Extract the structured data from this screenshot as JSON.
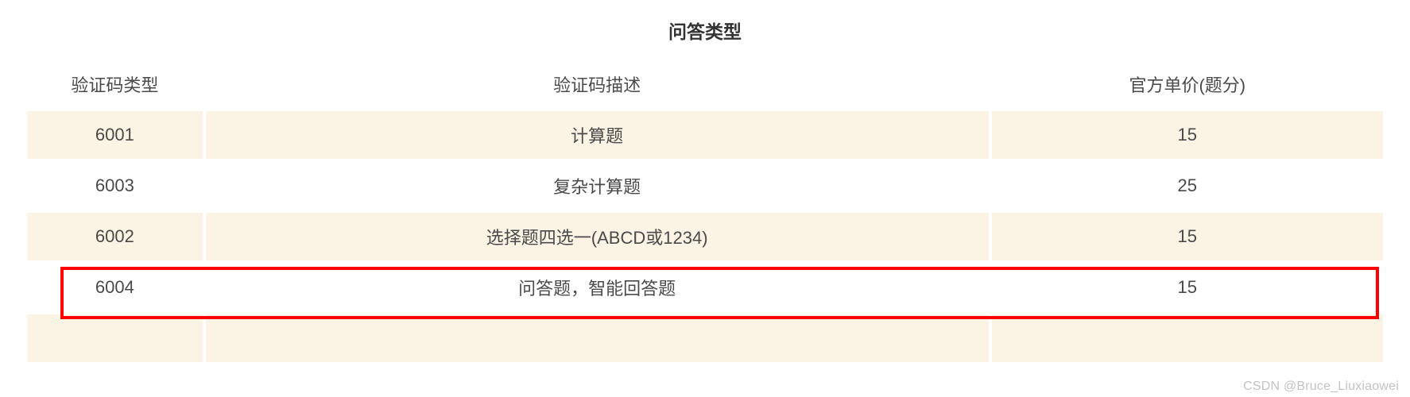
{
  "table": {
    "title": "问答类型",
    "columns": [
      "验证码类型",
      "验证码描述",
      "官方单价(题分)"
    ],
    "rows": [
      {
        "code": "6001",
        "desc": "计算题",
        "price": "15"
      },
      {
        "code": "6003",
        "desc": "复杂计算题",
        "price": "25"
      },
      {
        "code": "6002",
        "desc": "选择题四选一(ABCD或1234)",
        "price": "15"
      },
      {
        "code": "6004",
        "desc": "问答题，智能回答题",
        "price": "15"
      }
    ]
  },
  "watermark": "CSDN @Bruce_Liuxiaowei"
}
